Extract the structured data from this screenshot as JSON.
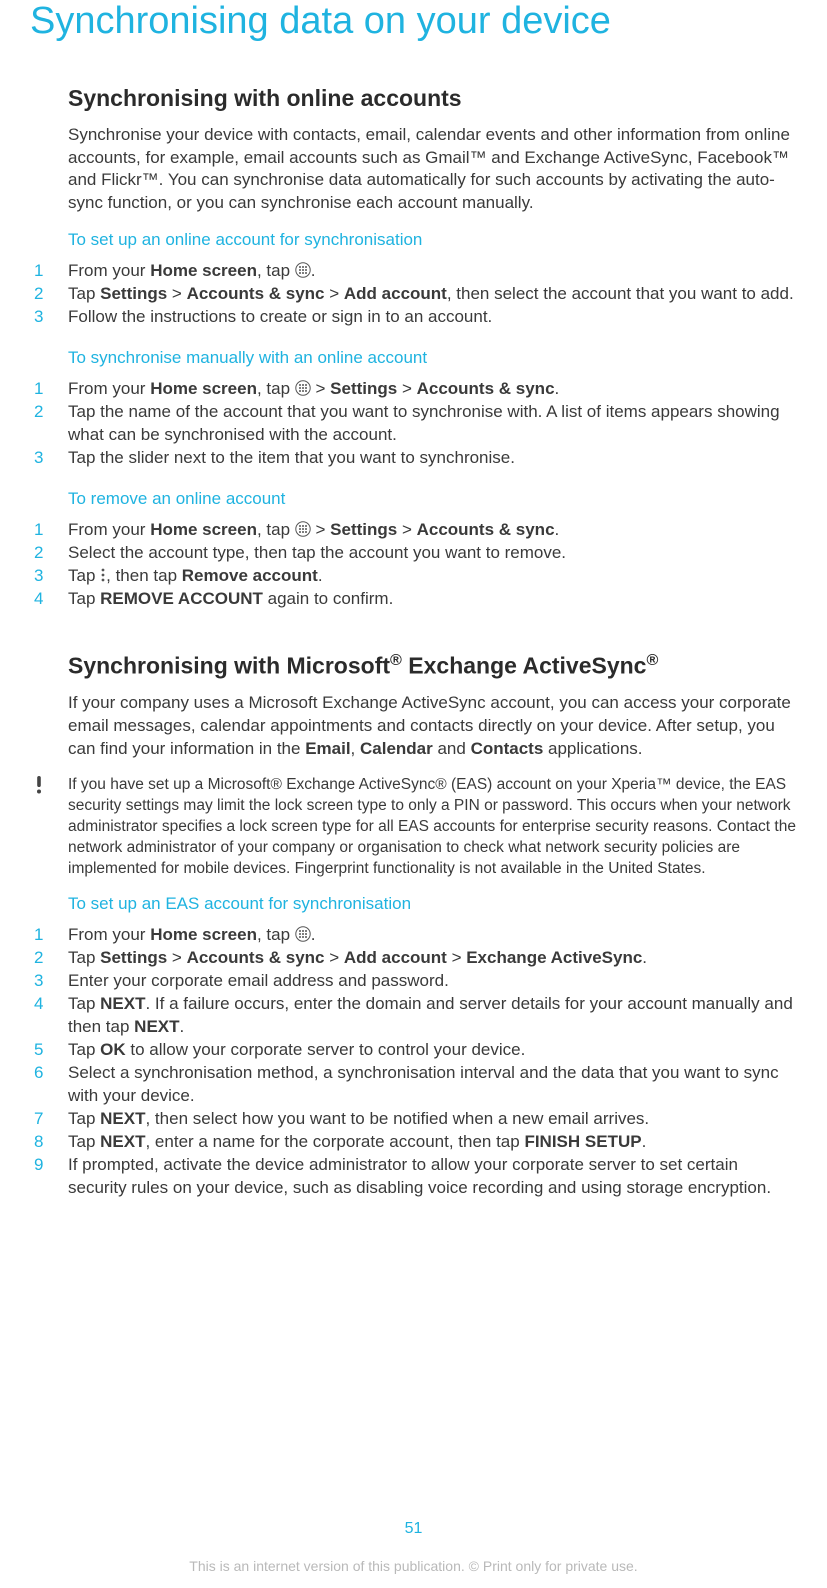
{
  "page": {
    "title": "Synchronising data on your device",
    "number": "51",
    "footer": "This is an internet version of this publication. © Print only for private use."
  },
  "section1": {
    "heading": "Synchronising with online accounts",
    "intro": "Synchronise your device with contacts, email, calendar events and other information from online accounts, for example, email accounts such as Gmail™ and Exchange ActiveSync, Facebook™ and Flickr™. You can synchronise data automatically for such accounts by activating the auto-sync function, or you can synchronise each account manually.",
    "proc1": {
      "heading": "To set up an online account for synchronisation",
      "steps": [
        {
          "n": "1",
          "prefix": "From your ",
          "b1": "Home screen",
          "mid": ", tap ",
          "suffix": "."
        },
        {
          "n": "2",
          "t1": "Tap ",
          "b1": "Settings",
          "t2": " > ",
          "b2": "Accounts & sync",
          "t3": " > ",
          "b3": "Add account",
          "t4": ", then select the account that you want to add."
        },
        {
          "n": "3",
          "t": "Follow the instructions to create or sign in to an account."
        }
      ]
    },
    "proc2": {
      "heading": "To synchronise manually with an online account",
      "steps": [
        {
          "n": "1",
          "t1": "From your ",
          "b1": "Home screen",
          "t2": ", tap ",
          "t3": " > ",
          "b2": "Settings",
          "t4": " > ",
          "b3": "Accounts & sync",
          "t5": "."
        },
        {
          "n": "2",
          "t": "Tap the name of the account that you want to synchronise with. A list of items appears showing what can be synchronised with the account."
        },
        {
          "n": "3",
          "t": "Tap the slider next to the item that you want to synchronise."
        }
      ]
    },
    "proc3": {
      "heading": "To remove an online account",
      "steps": [
        {
          "n": "1",
          "t1": "From your ",
          "b1": "Home screen",
          "t2": ", tap ",
          "t3": " > ",
          "b2": "Settings",
          "t4": " > ",
          "b3": "Accounts & sync",
          "t5": "."
        },
        {
          "n": "2",
          "t": "Select the account type, then tap the account you want to remove."
        },
        {
          "n": "3",
          "t1": "Tap ",
          "t2": ", then tap ",
          "b1": "Remove account",
          "t3": "."
        },
        {
          "n": "4",
          "t1": "Tap ",
          "b1": "REMOVE ACCOUNT",
          "t2": " again to confirm."
        }
      ]
    }
  },
  "section2": {
    "heading_pre": "Synchronising with Microsoft",
    "heading_mid": " Exchange ActiveSync",
    "sup": "®",
    "intro_t1": "If your company uses a Microsoft Exchange ActiveSync account, you can access your corporate email messages, calendar appointments and contacts directly on your device. After setup, you can find your information in the ",
    "b1": "Email",
    "sep1": ", ",
    "b2": "Calendar",
    "sep2": " and ",
    "b3": "Contacts",
    "intro_t2": " applications.",
    "note": "If you have set up a Microsoft® Exchange ActiveSync® (EAS) account on your Xperia™ device, the EAS security settings may limit the lock screen type to only a PIN or password. This occurs when your network administrator specifies a lock screen type for all EAS accounts for enterprise security reasons. Contact the network administrator of your company or organisation to check what network security policies are implemented for mobile devices. Fingerprint functionality is not available in the United States.",
    "proc1": {
      "heading": "To set up an EAS account for synchronisation",
      "steps": [
        {
          "n": "1",
          "t1": "From your ",
          "b1": "Home screen",
          "t2": ", tap ",
          "t3": "."
        },
        {
          "n": "2",
          "t1": "Tap ",
          "b1": "Settings",
          "t2": " > ",
          "b2": "Accounts & sync",
          "t3": " > ",
          "b3": "Add account",
          "t4": " > ",
          "b4": "Exchange ActiveSync",
          "t5": "."
        },
        {
          "n": "3",
          "t": "Enter your corporate email address and password."
        },
        {
          "n": "4",
          "t1": "Tap ",
          "b1": "NEXT",
          "t2": ". If a failure occurs, enter the domain and server details for your account manually and then tap ",
          "b2": "NEXT",
          "t3": "."
        },
        {
          "n": "5",
          "t1": "Tap ",
          "b1": "OK",
          "t2": " to allow your corporate server to control your device."
        },
        {
          "n": "6",
          "t": "Select a synchronisation method, a synchronisation interval and the data that you want to sync with your device."
        },
        {
          "n": "7",
          "t1": "Tap ",
          "b1": "NEXT",
          "t2": ", then select how you want to be notified when a new email arrives."
        },
        {
          "n": "8",
          "t1": "Tap ",
          "b1": "NEXT",
          "t2": ", enter a name for the corporate account, then tap ",
          "b2": "FINISH SETUP",
          "t3": "."
        },
        {
          "n": "9",
          "t": "If prompted, activate the device administrator to allow your corporate server to set certain security rules on your device, such as disabling voice recording and using storage encryption."
        }
      ]
    }
  }
}
